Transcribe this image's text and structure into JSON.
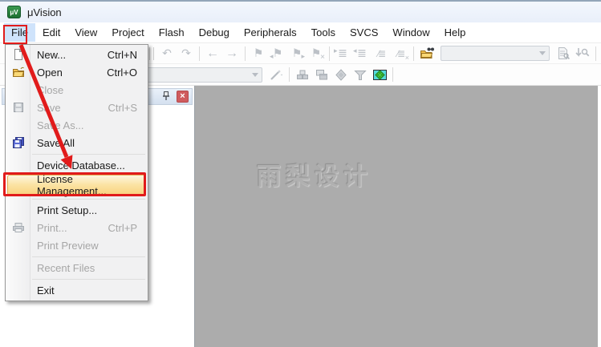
{
  "titlebar": {
    "title": "μVision"
  },
  "menubar": {
    "items": [
      "File",
      "Edit",
      "View",
      "Project",
      "Flash",
      "Debug",
      "Peripherals",
      "Tools",
      "SVCS",
      "Window",
      "Help"
    ],
    "active_item": "File"
  },
  "toolbar_main": {
    "groups": [
      [
        "undo",
        "redo"
      ],
      [
        "back",
        "forward"
      ],
      [
        "bookmark-toggle",
        "bookmark-prev",
        "bookmark-next",
        "bookmark-clear"
      ],
      [
        "indent",
        "outdent",
        "comment",
        "uncomment"
      ]
    ],
    "find_group": {
      "find_icon": "find-in-files",
      "combo_value": "",
      "after_icons": [
        "find-in-document",
        "incremental-find"
      ]
    }
  },
  "toolbar_build": {
    "combo_value": "",
    "icons_before": [
      "options-for-target"
    ],
    "icons_after": [
      "build",
      "batch-build",
      "download",
      "filter",
      "manage-run-time-environment"
    ]
  },
  "project_panel": {
    "pin_icon": "pin",
    "close_icon": "close"
  },
  "editor": {
    "watermark": "雨梨设计"
  },
  "file_menu": {
    "items": [
      {
        "label": "New...",
        "shortcut": "Ctrl+N",
        "icon": "new-file",
        "state": "enabled"
      },
      {
        "label": "Open",
        "shortcut": "Ctrl+O",
        "icon": "open-folder",
        "state": "enabled"
      },
      {
        "label": "Close",
        "shortcut": "",
        "icon": "",
        "state": "disabled"
      },
      {
        "label": "Save",
        "shortcut": "Ctrl+S",
        "icon": "save",
        "state": "disabled"
      },
      {
        "label": "Save As...",
        "shortcut": "",
        "icon": "",
        "state": "disabled"
      },
      {
        "label": "Save All",
        "shortcut": "",
        "icon": "save-all",
        "state": "enabled"
      },
      {
        "type": "separator"
      },
      {
        "label": "Device Database...",
        "shortcut": "",
        "icon": "",
        "state": "enabled"
      },
      {
        "label": "License Management...",
        "shortcut": "",
        "icon": "",
        "state": "enabled",
        "highlighted": true,
        "annotated": true
      },
      {
        "type": "separator"
      },
      {
        "label": "Print Setup...",
        "shortcut": "",
        "icon": "",
        "state": "enabled"
      },
      {
        "label": "Print...",
        "shortcut": "Ctrl+P",
        "icon": "print",
        "state": "disabled"
      },
      {
        "label": "Print Preview",
        "shortcut": "",
        "icon": "",
        "state": "disabled"
      },
      {
        "type": "separator"
      },
      {
        "label": "Recent Files",
        "shortcut": "",
        "icon": "",
        "state": "disabled"
      },
      {
        "type": "separator"
      },
      {
        "label": "Exit",
        "shortcut": "",
        "icon": "",
        "state": "enabled"
      }
    ]
  },
  "annotations": {
    "color": "#e11b1b",
    "boxed_items": [
      "File menubar item",
      "License Management... menu item"
    ],
    "arrow": "from File menu to License Management..."
  }
}
